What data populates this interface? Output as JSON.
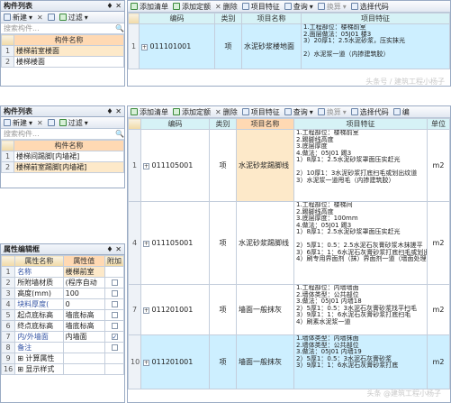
{
  "top_left": {
    "title": "构件列表",
    "pin": "♦ ✕",
    "toolbar": [
      "新建",
      "过滤"
    ],
    "search_placeholder": "搜索构件...",
    "col": "构件名称",
    "rows": [
      {
        "n": "1",
        "name": "楼梯前室楼面"
      },
      {
        "n": "2",
        "name": "楼梯楼面"
      }
    ]
  },
  "top_right": {
    "toolbar": [
      "添加清单",
      "添加定额",
      "删除",
      "项目特征",
      "查询",
      "换算",
      "选择代码"
    ],
    "headers": [
      "编码",
      "类别",
      "项目名称",
      "项目特征"
    ],
    "rows": [
      {
        "n": "1",
        "code": "011101001",
        "type": "项",
        "name": "水泥砂浆楼地面",
        "feat": "1.工程部位：楼梯前室\n2.面层做法：05J01 楼3\n3）20厚1：2.5水泥砂浆，压实抹光\n\n2）水泥浆一道（内掺建筑胶）"
      }
    ],
    "watermark": "头条号 / 建筑工程小杨子"
  },
  "left": {
    "title": "构件列表",
    "pin": "♦ ✕",
    "toolbar": [
      "新建",
      "过滤"
    ],
    "search_placeholder": "搜索构件...",
    "col": "构件名称",
    "rows": [
      {
        "n": "1",
        "name": "楼梯间踢脚[内墙裙]"
      },
      {
        "n": "2",
        "name": "楼梯前室踢脚[内墙裙]"
      }
    ]
  },
  "props": {
    "title": "属性编辑框",
    "pin": "♦ ✕",
    "headers": [
      "属性名称",
      "属性值",
      "附加"
    ],
    "rows": [
      {
        "n": "1",
        "name": "名称",
        "val": "楼梯前室",
        "chk": ""
      },
      {
        "n": "2",
        "name": "所附墙材质",
        "val": "(程序自动",
        "chk": "off"
      },
      {
        "n": "3",
        "name": "高度(mm)",
        "val": "100",
        "chk": "off"
      },
      {
        "n": "4",
        "name": "块料厚度(",
        "val": "0",
        "chk": "off"
      },
      {
        "n": "5",
        "name": "起点底标高",
        "val": "墙底标高",
        "chk": "off"
      },
      {
        "n": "6",
        "name": "终点底标高",
        "val": "墙底标高",
        "chk": "off"
      },
      {
        "n": "7",
        "name": "内/外墙面",
        "val": "内墙面",
        "chk": "on"
      },
      {
        "n": "8",
        "name": "备注",
        "val": "",
        "chk": "off"
      },
      {
        "n": "9",
        "name": "⊞ 计算属性",
        "val": "",
        "chk": ""
      },
      {
        "n": "16",
        "name": "⊞ 显示样式",
        "val": "",
        "chk": ""
      }
    ]
  },
  "main": {
    "toolbar": [
      "添加清单",
      "添加定额",
      "删除",
      "项目特征",
      "查询",
      "换算",
      "选择代码",
      "编"
    ],
    "headers": [
      "编码",
      "类别",
      "项目名称",
      "项目特征",
      "单位"
    ],
    "rows": [
      {
        "n": "1",
        "code": "011105001",
        "type": "项",
        "name": "水泥砂浆踢脚线",
        "feat": "1.工程部位：楼梯前室\n2.踢脚线高度\n3.底层厚度\n4.做法：05J01 踢3\n1）8厚1：2.5水泥砂浆罩面压实赶光\n\n2）10厚1：3水泥砂浆打底扫毛或划出纹道\n3）水泥浆一道甩毛（内掺建筑胶）",
        "unit": "m2"
      },
      {
        "n": "4",
        "code": "011105001",
        "type": "项",
        "name": "水泥砂浆踢脚线",
        "feat": "1.工程部位：楼梯间\n2.踢脚线高度\n3.底层厚度：100mm\n4.做法：05J01 踢3\n1）8厚1：2.5水泥砂浆罩面压实赶光\n\n2）5厚1：0.5：2.5水泥石灰膏砂浆木抹搓平\n3）6厚1：1：6水泥石灰膏砂浆打底扫毛或划出纹道\n4）刷专用界面剂（抹）界面剂一道（墙面处理清底）",
        "unit": "m2"
      },
      {
        "n": "7",
        "code": "011201001",
        "type": "项",
        "name": "墙面一般抹灰",
        "feat": "1.工程部位：内墙墙面\n2.墙体类型：公共部位\n3.做法：05J01 内墙18\n2）5厚1：0.5：3水泥石灰膏砂浆找平扫毛\n3）9厚1：1：6水泥石灰膏砂浆打底扫毛\n4）刷素水泥浆一道",
        "unit": "m2"
      },
      {
        "n": "10",
        "code": "011201001",
        "type": "项",
        "name": "墙面一般抹灰",
        "feat": "1.墙体类型：内墙抹面\n2.墙体类型：公共部位\n3.做法：05J01 内墙19\n2）5厚1：0.5：3水泥石灰膏砂浆\n3）9厚1：1：6水泥石灰膏砂浆打底\n\n",
        "unit": "m2"
      }
    ],
    "watermark": "头条 @建筑工程小杨子"
  }
}
